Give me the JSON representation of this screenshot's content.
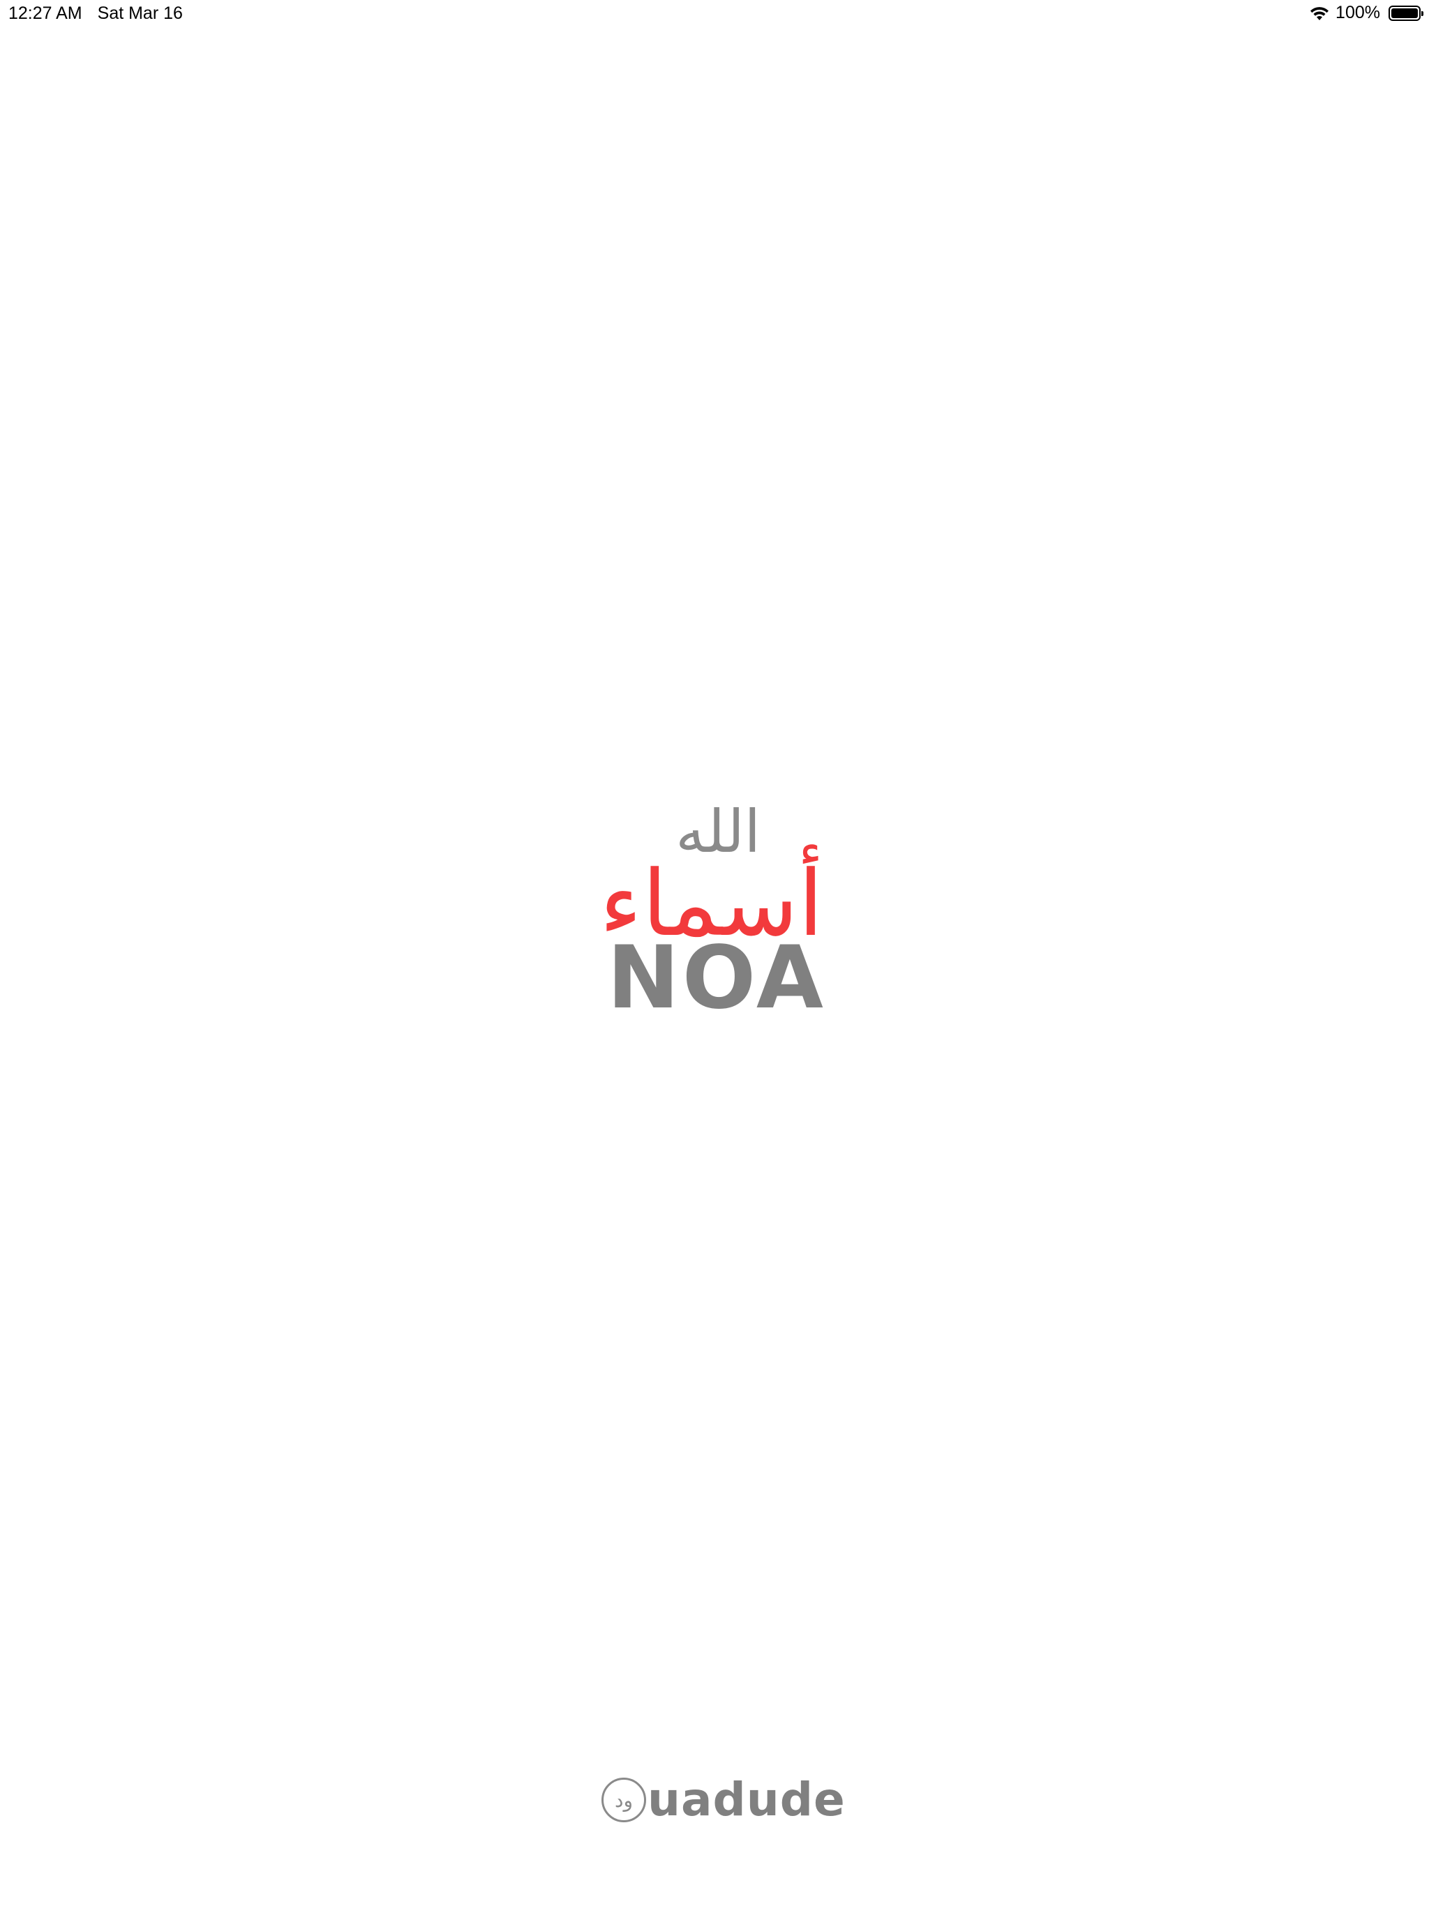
{
  "status_bar": {
    "time": "12:27 AM",
    "date": "Sat Mar 16",
    "battery_percent": "100%",
    "battery_level": 1.0,
    "icons": [
      "wifi-icon",
      "battery-icon"
    ]
  },
  "logo": {
    "allah_text": "الله",
    "asma_text": "أسماء",
    "noa_text": "NOA",
    "colors": {
      "gray": "#808080",
      "red": "#f23a3c"
    }
  },
  "brand": {
    "badge_text": "ود",
    "text": "uadude"
  }
}
